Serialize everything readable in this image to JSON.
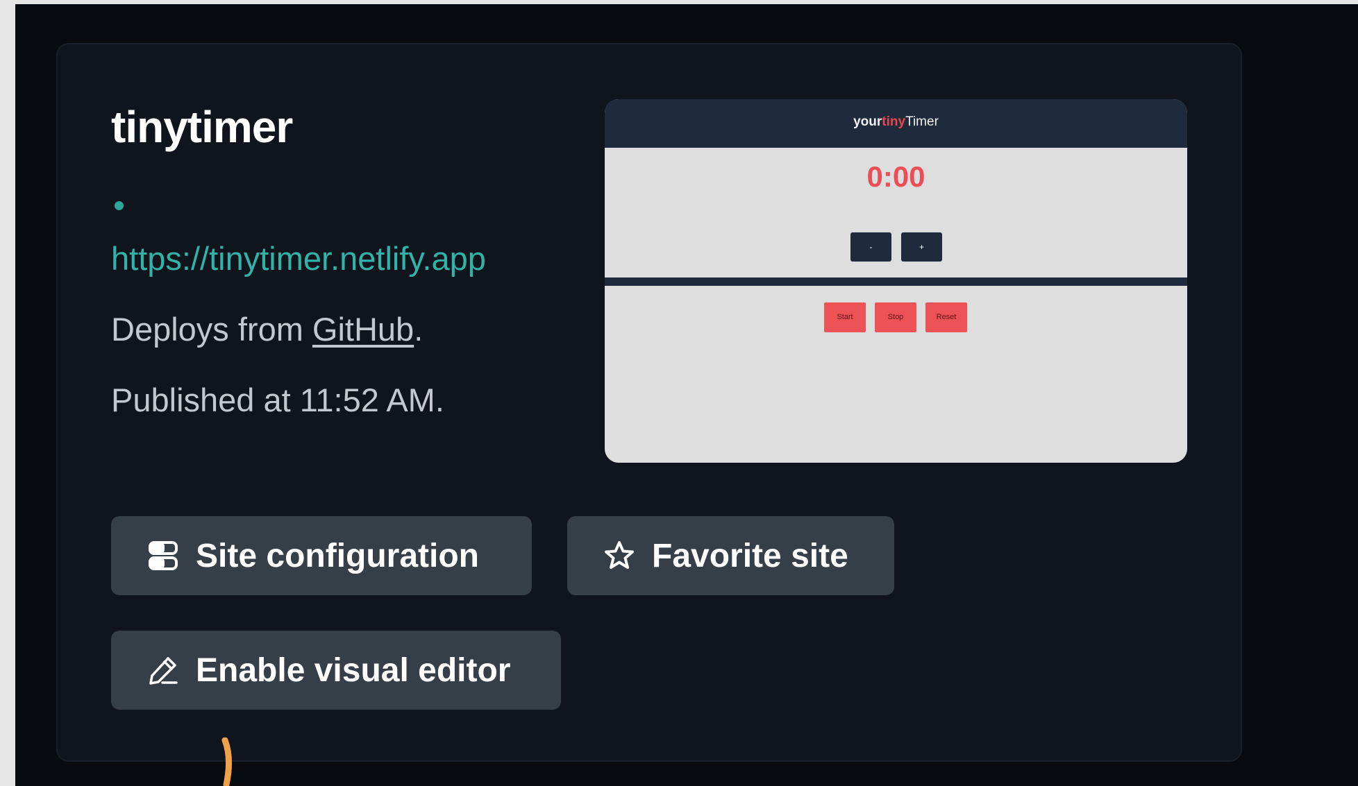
{
  "site": {
    "name": "tinytimer",
    "url": "https://tinytimer.netlify.app",
    "deploy_prefix": "Deploys from ",
    "deploy_source": "GitHub",
    "deploy_suffix": ".",
    "published": "Published at 11:52 AM.",
    "status_color": "#2ea79a"
  },
  "preview": {
    "brand_your": "your",
    "brand_tiny": "tiny",
    "brand_timer": "Timer",
    "time": "0:00",
    "minus_label": "-",
    "plus_label": "+",
    "start_label": "Start",
    "stop_label": "Stop",
    "reset_label": "Reset",
    "accent_color": "#e5484d"
  },
  "actions": {
    "site_configuration": {
      "label": "Site configuration",
      "icon": "server-icon"
    },
    "favorite_site": {
      "label": "Favorite site",
      "icon": "star-icon"
    },
    "enable_visual_editor": {
      "label": "Enable visual editor",
      "icon": "pencil-icon"
    }
  },
  "colors": {
    "background": "#080b10",
    "card": "#0f141d",
    "button": "#363e48",
    "link": "#32b3a7"
  }
}
